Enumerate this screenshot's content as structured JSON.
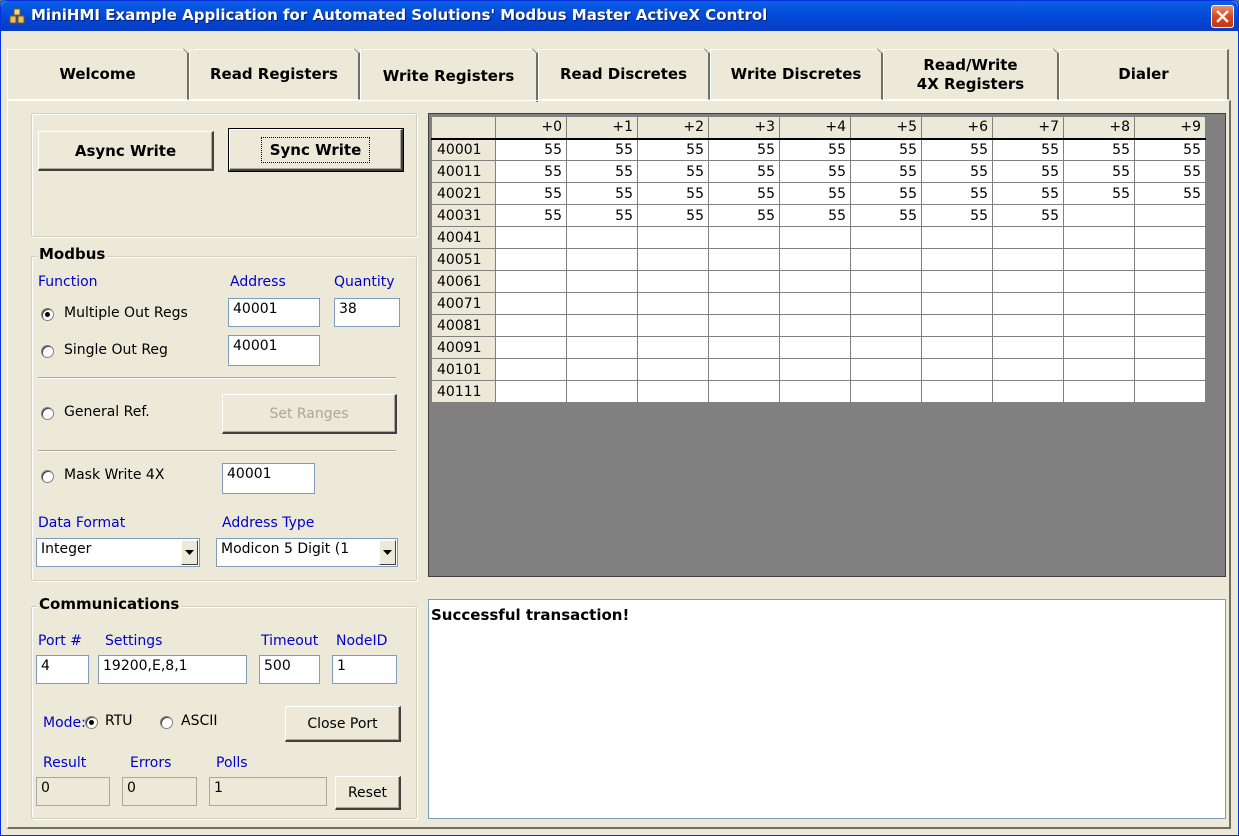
{
  "window": {
    "title": "MiniHMI Example Application for Automated Solutions' Modbus Master ActiveX Control"
  },
  "tabs": [
    {
      "label": "Welcome",
      "underline": "e"
    },
    {
      "label": "Read Registers"
    },
    {
      "label": "Write Registers",
      "active": true
    },
    {
      "label": "Read Discretes"
    },
    {
      "label": "Write Discretes"
    },
    {
      "label": "Read/Write 4X Registers"
    },
    {
      "label": "Dialer"
    }
  ],
  "actions": {
    "async_write": "Async Write",
    "sync_write": "Sync Write"
  },
  "modbus": {
    "title": "Modbus",
    "function_label": "Function",
    "address_label": "Address",
    "quantity_label": "Quantity",
    "multiple_out_regs": "Multiple Out Regs",
    "multiple_address": "40001",
    "quantity": "38",
    "single_out_reg": "Single Out Reg",
    "single_address": "40001",
    "general_ref": "General Ref.",
    "set_ranges": "Set Ranges",
    "mask_write": "Mask Write 4X",
    "mask_address": "40001",
    "data_format_label": "Data Format",
    "data_format": "Integer",
    "address_type_label": "Address Type",
    "address_type": "Modicon 5 Digit (1"
  },
  "communications": {
    "title": "Communications",
    "port_label": "Port #",
    "settings_label": "Settings",
    "timeout_label": "Timeout",
    "nodeid_label": "NodeID",
    "port": "4",
    "settings": "19200,E,8,1",
    "timeout": "500",
    "nodeid": "1",
    "mode_label": "Mode:",
    "rtu": "RTU",
    "ascii": "ASCII",
    "close_port": "Close Port",
    "result_label": "Result",
    "errors_label": "Errors",
    "polls_label": "Polls",
    "result": "0",
    "errors": "0",
    "polls": "1",
    "reset": "Reset"
  },
  "grid": {
    "columns": [
      "+0",
      "+1",
      "+2",
      "+3",
      "+4",
      "+5",
      "+6",
      "+7",
      "+8",
      "+9"
    ],
    "rows": [
      {
        "addr": "40001",
        "values": [
          "55",
          "55",
          "55",
          "55",
          "55",
          "55",
          "55",
          "55",
          "55",
          "55"
        ]
      },
      {
        "addr": "40011",
        "values": [
          "55",
          "55",
          "55",
          "55",
          "55",
          "55",
          "55",
          "55",
          "55",
          "55"
        ]
      },
      {
        "addr": "40021",
        "values": [
          "55",
          "55",
          "55",
          "55",
          "55",
          "55",
          "55",
          "55",
          "55",
          "55"
        ]
      },
      {
        "addr": "40031",
        "values": [
          "55",
          "55",
          "55",
          "55",
          "55",
          "55",
          "55",
          "55",
          "",
          ""
        ]
      },
      {
        "addr": "40041",
        "values": [
          "",
          "",
          "",
          "",
          "",
          "",
          "",
          "",
          "",
          ""
        ]
      },
      {
        "addr": "40051",
        "values": [
          "",
          "",
          "",
          "",
          "",
          "",
          "",
          "",
          "",
          ""
        ]
      },
      {
        "addr": "40061",
        "values": [
          "",
          "",
          "",
          "",
          "",
          "",
          "",
          "",
          "",
          ""
        ]
      },
      {
        "addr": "40071",
        "values": [
          "",
          "",
          "",
          "",
          "",
          "",
          "",
          "",
          "",
          ""
        ]
      },
      {
        "addr": "40081",
        "values": [
          "",
          "",
          "",
          "",
          "",
          "",
          "",
          "",
          "",
          ""
        ]
      },
      {
        "addr": "40091",
        "values": [
          "",
          "",
          "",
          "",
          "",
          "",
          "",
          "",
          "",
          ""
        ]
      },
      {
        "addr": "40101",
        "values": [
          "",
          "",
          "",
          "",
          "",
          "",
          "",
          "",
          "",
          ""
        ]
      },
      {
        "addr": "40111",
        "values": [
          "",
          "",
          "",
          "",
          "",
          "",
          "",
          "",
          "",
          ""
        ]
      }
    ]
  },
  "status": {
    "message": "Successful transaction!"
  }
}
